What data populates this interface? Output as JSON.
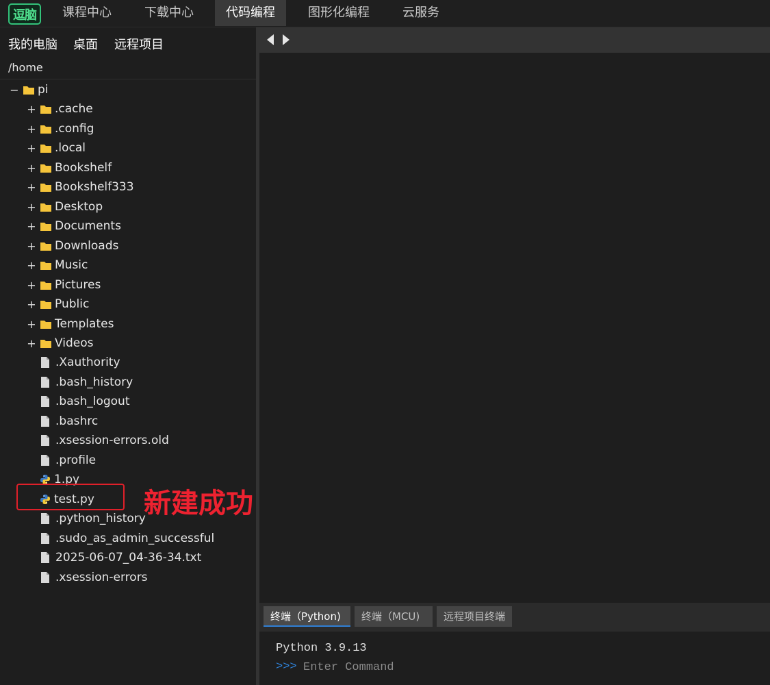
{
  "logo": {
    "text": "逗脑"
  },
  "nav": {
    "tabs": [
      {
        "label": "课程中心"
      },
      {
        "label": "下载中心"
      },
      {
        "label": "代码编程",
        "active": true
      },
      {
        "label": "图形化编程"
      },
      {
        "label": "云服务"
      }
    ]
  },
  "sidebar": {
    "source_tabs": [
      {
        "label": "我的电脑"
      },
      {
        "label": "桌面"
      },
      {
        "label": "远程项目"
      }
    ],
    "path": "/home",
    "root": {
      "label": "pi",
      "toggle": "−"
    },
    "folders": [
      {
        "label": ".cache",
        "toggle": "+"
      },
      {
        "label": ".config",
        "toggle": "+"
      },
      {
        "label": ".local",
        "toggle": "+"
      },
      {
        "label": "Bookshelf",
        "toggle": "+"
      },
      {
        "label": "Bookshelf333",
        "toggle": "+"
      },
      {
        "label": "Desktop",
        "toggle": "+"
      },
      {
        "label": "Documents",
        "toggle": "+"
      },
      {
        "label": "Downloads",
        "toggle": "+"
      },
      {
        "label": "Music",
        "toggle": "+"
      },
      {
        "label": "Pictures",
        "toggle": "+"
      },
      {
        "label": "Public",
        "toggle": "+"
      },
      {
        "label": "Templates",
        "toggle": "+"
      },
      {
        "label": "Videos",
        "toggle": "+"
      }
    ],
    "files": [
      {
        "label": ".Xauthority",
        "icon": "file-icon"
      },
      {
        "label": ".bash_history",
        "icon": "file-icon"
      },
      {
        "label": ".bash_logout",
        "icon": "file-icon"
      },
      {
        "label": ".bashrc",
        "icon": "file-icon"
      },
      {
        "label": ".xsession-errors.old",
        "icon": "file-icon"
      },
      {
        "label": ".profile",
        "icon": "file-icon"
      },
      {
        "label": "1.py",
        "icon": "python-icon"
      },
      {
        "label": "test.py",
        "icon": "python-icon"
      },
      {
        "label": ".python_history",
        "icon": "file-icon"
      },
      {
        "label": ".sudo_as_admin_successful",
        "icon": "file-icon"
      },
      {
        "label": "2025-06-07_04-36-34.txt",
        "icon": "file-icon"
      },
      {
        "label": ".xsession-errors",
        "icon": "file-icon"
      }
    ]
  },
  "annotation": {
    "text": "新建成功",
    "color": "#ee2230"
  },
  "terminal": {
    "tabs": [
      {
        "label": "终端（Python)",
        "active": true
      },
      {
        "label": "终端（MCU)"
      },
      {
        "label": "远程项目终端"
      }
    ],
    "output_line": "Python 3.9.13",
    "prompt": ">>>",
    "placeholder": "Enter Command"
  },
  "colors": {
    "accent": "#2f7fd6",
    "folder": "#f5c43a",
    "highlight": "#e0202a"
  }
}
